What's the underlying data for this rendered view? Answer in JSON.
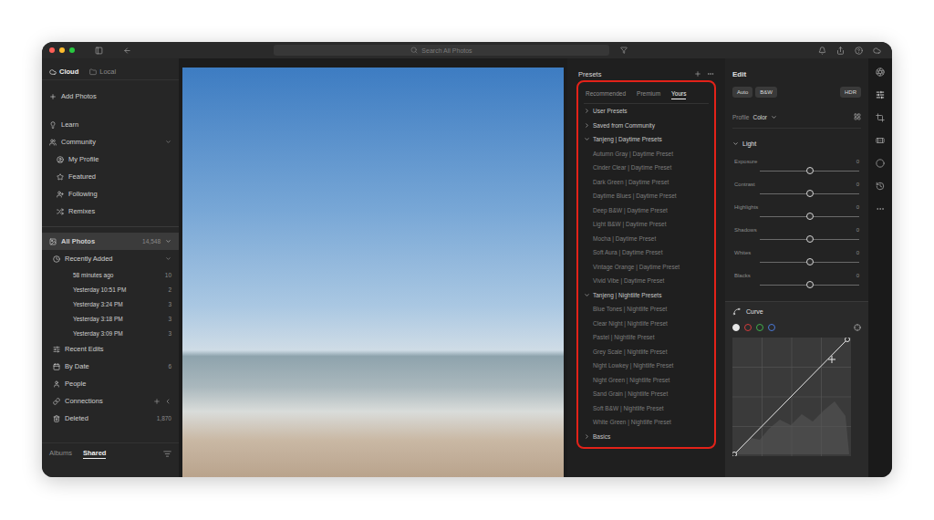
{
  "topbar": {
    "search_placeholder": "Search All Photos"
  },
  "sidebar": {
    "tabs": [
      {
        "label": "Cloud",
        "selected": true
      },
      {
        "label": "Local",
        "selected": false
      }
    ],
    "add_photos": "Add Photos",
    "learn": "Learn",
    "community": {
      "label": "Community",
      "expanded": true,
      "items": [
        "My Profile",
        "Featured",
        "Following",
        "Remixes"
      ]
    },
    "all_photos": {
      "label": "All Photos",
      "count": "14,548",
      "expanded": true,
      "selected": true
    },
    "recently_added": {
      "label": "Recently Added",
      "expanded": true,
      "items": [
        {
          "label": "58 minutes ago",
          "count": "10"
        },
        {
          "label": "Yesterday 10:51 PM",
          "count": "2"
        },
        {
          "label": "Yesterday 3:24 PM",
          "count": "3"
        },
        {
          "label": "Yesterday 3:18 PM",
          "count": "3"
        },
        {
          "label": "Yesterday 3:09 PM",
          "count": "3"
        }
      ]
    },
    "nav": [
      {
        "label": "Recent Edits",
        "count": ""
      },
      {
        "label": "By Date",
        "count": "6"
      },
      {
        "label": "People",
        "count": ""
      },
      {
        "label": "Connections",
        "count": ""
      },
      {
        "label": "Deleted",
        "count": "1,870"
      }
    ],
    "bottom_tabs": [
      {
        "label": "Albums",
        "selected": false
      },
      {
        "label": "Shared",
        "selected": true
      }
    ]
  },
  "presets": {
    "title": "Presets",
    "tabs": [
      {
        "label": "Recommended",
        "selected": false
      },
      {
        "label": "Premium",
        "selected": false
      },
      {
        "label": "Yours",
        "selected": true
      }
    ],
    "groups": [
      {
        "label": "User Presets",
        "expanded": false,
        "items": []
      },
      {
        "label": "Saved from Community",
        "expanded": false,
        "items": []
      },
      {
        "label": "Tanjeng | Daytime Presets",
        "expanded": true,
        "items": [
          "Autumn Gray | Daytime Preset",
          "Cinder Clear | Daytime Preset",
          "Dark Green | Daytime Preset",
          "Daytime Blues | Daytime Preset",
          "Deep B&W | Daytime Preset",
          "Light B&W | Daytime Preset",
          "Mocha | Daytime Preset",
          "Soft Aura | Daytime Preset",
          "Vintage Orange | Daytime Preset",
          "Vivid Vibe | Daytime Preset"
        ]
      },
      {
        "label": "Tanjeng | Nightlife Presets",
        "expanded": true,
        "items": [
          "Blue Tones | Nightlife Preset",
          "Clear Night | Nightlife Preset",
          "Pastel | Nightlife Preset",
          "Grey Scale | Nightlife Preset",
          "Night Lowkey | Nightlife Preset",
          "Night Green | Nightlife Preset",
          "Sand Grain | Nightlife Preset",
          "Soft B&W | Nightlife Preset",
          "White Green | Nightlife Preset"
        ]
      },
      {
        "label": "Basics",
        "expanded": false,
        "items": []
      }
    ]
  },
  "edit": {
    "title": "Edit",
    "buttons": [
      "Auto",
      "B&W"
    ],
    "hdr": "HDR",
    "profile": {
      "label": "Profile",
      "value": "Color"
    },
    "light": {
      "label": "Light",
      "expanded": true,
      "sliders": [
        {
          "name": "Exposure",
          "value": "0",
          "level": 0.5
        },
        {
          "name": "Contrast",
          "value": "0",
          "level": 0.5
        },
        {
          "name": "Highlights",
          "value": "0",
          "level": 0.5
        },
        {
          "name": "Shadows",
          "value": "0",
          "level": 0.5
        },
        {
          "name": "Whites",
          "value": "0",
          "level": 0.5
        },
        {
          "name": "Blacks",
          "value": "0",
          "level": 0.5
        }
      ]
    },
    "curve": {
      "label": "Curve",
      "channels": [
        {
          "selected": true,
          "color": "#e6e6e6"
        },
        {
          "selected": false,
          "color": "#d23c3c"
        },
        {
          "selected": false,
          "color": "#3fae4b"
        },
        {
          "selected": false,
          "color": "#4a78d6"
        }
      ],
      "points": [
        [
          0,
          0
        ],
        [
          1,
          1
        ]
      ]
    }
  }
}
